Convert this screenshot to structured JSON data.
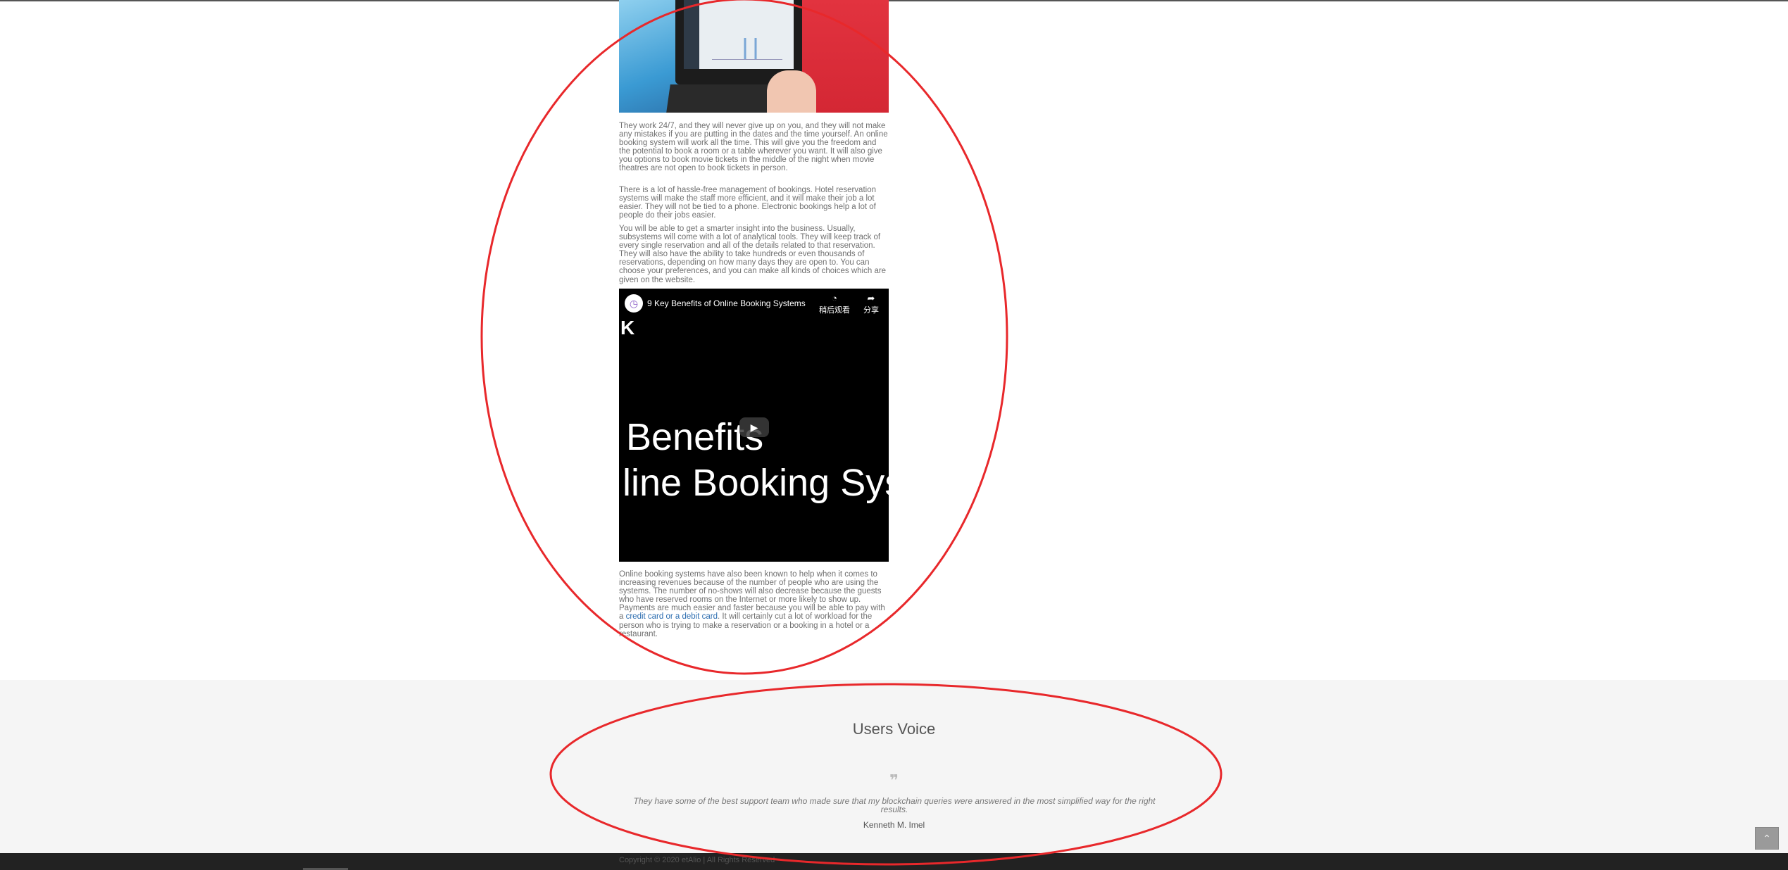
{
  "article": {
    "hero_image": "woman-using-laptop-booking-dashboard",
    "paragraphs": [
      "They work 24/7, and they will never give up on you, and they will not make any mistakes if you are putting in the dates and the time yourself. An online booking system will work all the time. This will give you the freedom and the potential to book a room or a table wherever you want. It will also give you options to book movie tickets in the middle of the night when movie theatres are not open to book tickets in person.",
      "There is a lot of hassle-free management of bookings. Hotel reservation systems will make the staff more efficient, and it will make their job a lot easier. They will not be tied to a phone. Electronic bookings help a lot of people do their jobs easier.",
      "You will be able to get a smarter insight into the business. Usually, subsystems will come with a lot of analytical tools. They will keep track of every single reservation and all of the details related to that reservation. They will also have the ability to take hundreds or even thousands of reservations, depending on how many days they are open to. You can choose your preferences, and you can make all kinds of choices which are given on the website."
    ],
    "video": {
      "title": "9 Key Benefits of Online Booking Systems",
      "watch_later_label": "稍后观看",
      "share_label": "分享",
      "frame_line1": "Benefits",
      "frame_line2": "line Booking Sys",
      "corner_mark": "K",
      "play_icon": "play-icon"
    },
    "closing": {
      "before_link": "Online booking systems have also been known to help when it comes to increasing revenues because of the number of people who are using the systems. The number of no-shows will also decrease because the guests who have reserved rooms on the Internet or more likely to show up. Payments are much easier and faster because you will be able to pay with a ",
      "link_text": "credit card or a debit card",
      "after_link": ". It will certainly cut a lot of workload for the person who is trying to make a reservation or a booking in a hotel or a restaurant."
    }
  },
  "testimonials": {
    "title": "Users Voice",
    "quote_icon": "quote-icon",
    "quote": "They have some of the best support team who made sure that my blockchain queries were answered in the most simplified way for the right results.",
    "author": "Kenneth M. Imel"
  },
  "footer": {
    "copyright": "Copyright © 2020 etAlio | All Rights Reserved"
  },
  "colors": {
    "annotation": "#e8282b",
    "band_bg": "#f5f5f5",
    "footer_bg": "#222222",
    "link": "#2c6db0"
  }
}
